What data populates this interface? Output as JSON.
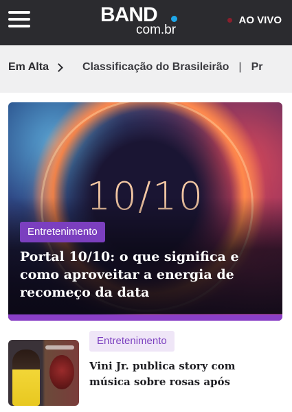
{
  "header": {
    "logo_main": "BAND",
    "logo_sub": "com.br",
    "live_label": "AO VIVO",
    "accent_color": "#1ea7e8",
    "live_dot_color": "#8a1f2c"
  },
  "trending": {
    "label": "Em Alta",
    "items": [
      "Classificação do Brasileirão",
      "Pr"
    ]
  },
  "hero": {
    "image_text": "10/10",
    "category": "Entretenimento",
    "title": "Portal 10/10: o que significa e como aproveitar a energia de recomeço da data",
    "accent_color": "#8a3fc7"
  },
  "second_article": {
    "category": "Entretenimento",
    "title": "Vini Jr. publica story com música sobre rosas após"
  }
}
